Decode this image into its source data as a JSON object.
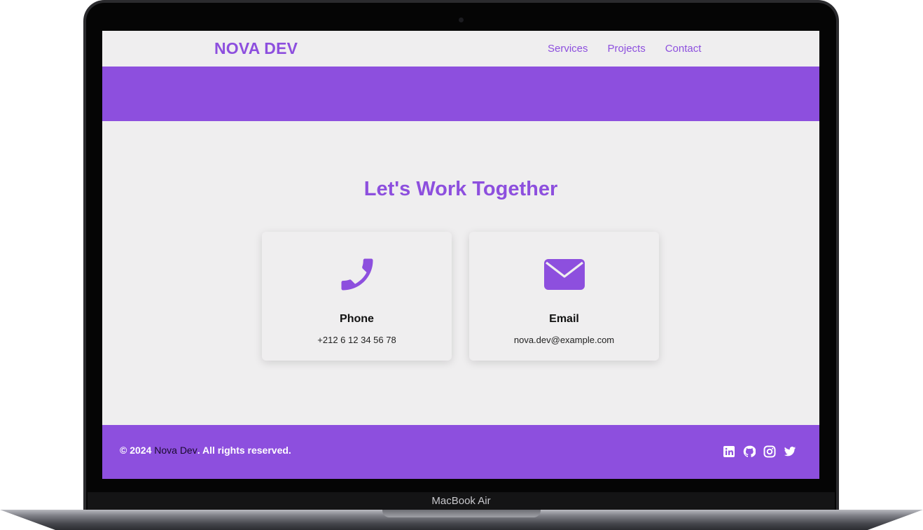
{
  "device": {
    "label": "MacBook Air"
  },
  "navbar": {
    "logo": "NOVA DEV",
    "links": [
      {
        "label": "Services"
      },
      {
        "label": "Projects"
      },
      {
        "label": "Contact"
      }
    ]
  },
  "contact": {
    "title": "Let's Work Together",
    "cards": [
      {
        "icon": "phone-icon",
        "title": "Phone",
        "value": "+212 6 12 34 56 78"
      },
      {
        "icon": "envelope-icon",
        "title": "Email",
        "value": "nova.dev@example.com"
      }
    ]
  },
  "footer": {
    "copyright_prefix": "© 2024 ",
    "brand": "Nova Dev",
    "copyright_suffix": ". All rights reserved.",
    "socials": [
      "linkedin-icon",
      "github-icon",
      "instagram-icon",
      "twitter-icon"
    ]
  },
  "colors": {
    "accent": "#8d4fde",
    "background": "#efeeef",
    "text": "#111111"
  }
}
